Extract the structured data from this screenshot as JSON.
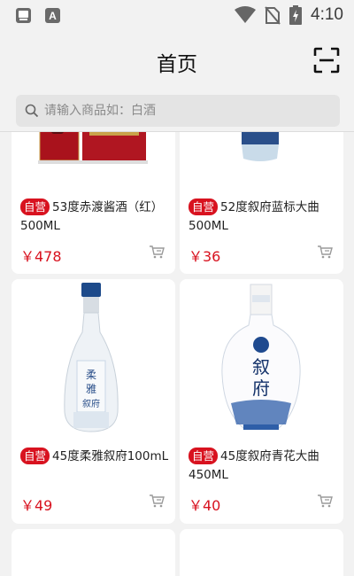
{
  "status_bar": {
    "time": "4:10",
    "app_icon_2_letter": "A"
  },
  "header": {
    "title": "首页"
  },
  "search": {
    "placeholder": "请输入商品如：白酒"
  },
  "products": [
    {
      "badge": "自营",
      "name": "53度赤渡酱酒（红）500ML",
      "price": "￥478"
    },
    {
      "badge": "自营",
      "name": "52度叙府蓝标大曲500ML",
      "price": "￥36"
    },
    {
      "badge": "自营",
      "name": "45度柔雅叙府100mL",
      "price": "￥49"
    },
    {
      "badge": "自营",
      "name": "45度叙府青花大曲450ML",
      "price": "￥40"
    }
  ],
  "colors": {
    "accent_red": "#d8121f",
    "background": "#f2f2f2"
  },
  "icons": [
    "wifi-icon",
    "no-sim-icon",
    "battery-charging-icon",
    "scan-icon",
    "search-icon",
    "cart-icon"
  ]
}
